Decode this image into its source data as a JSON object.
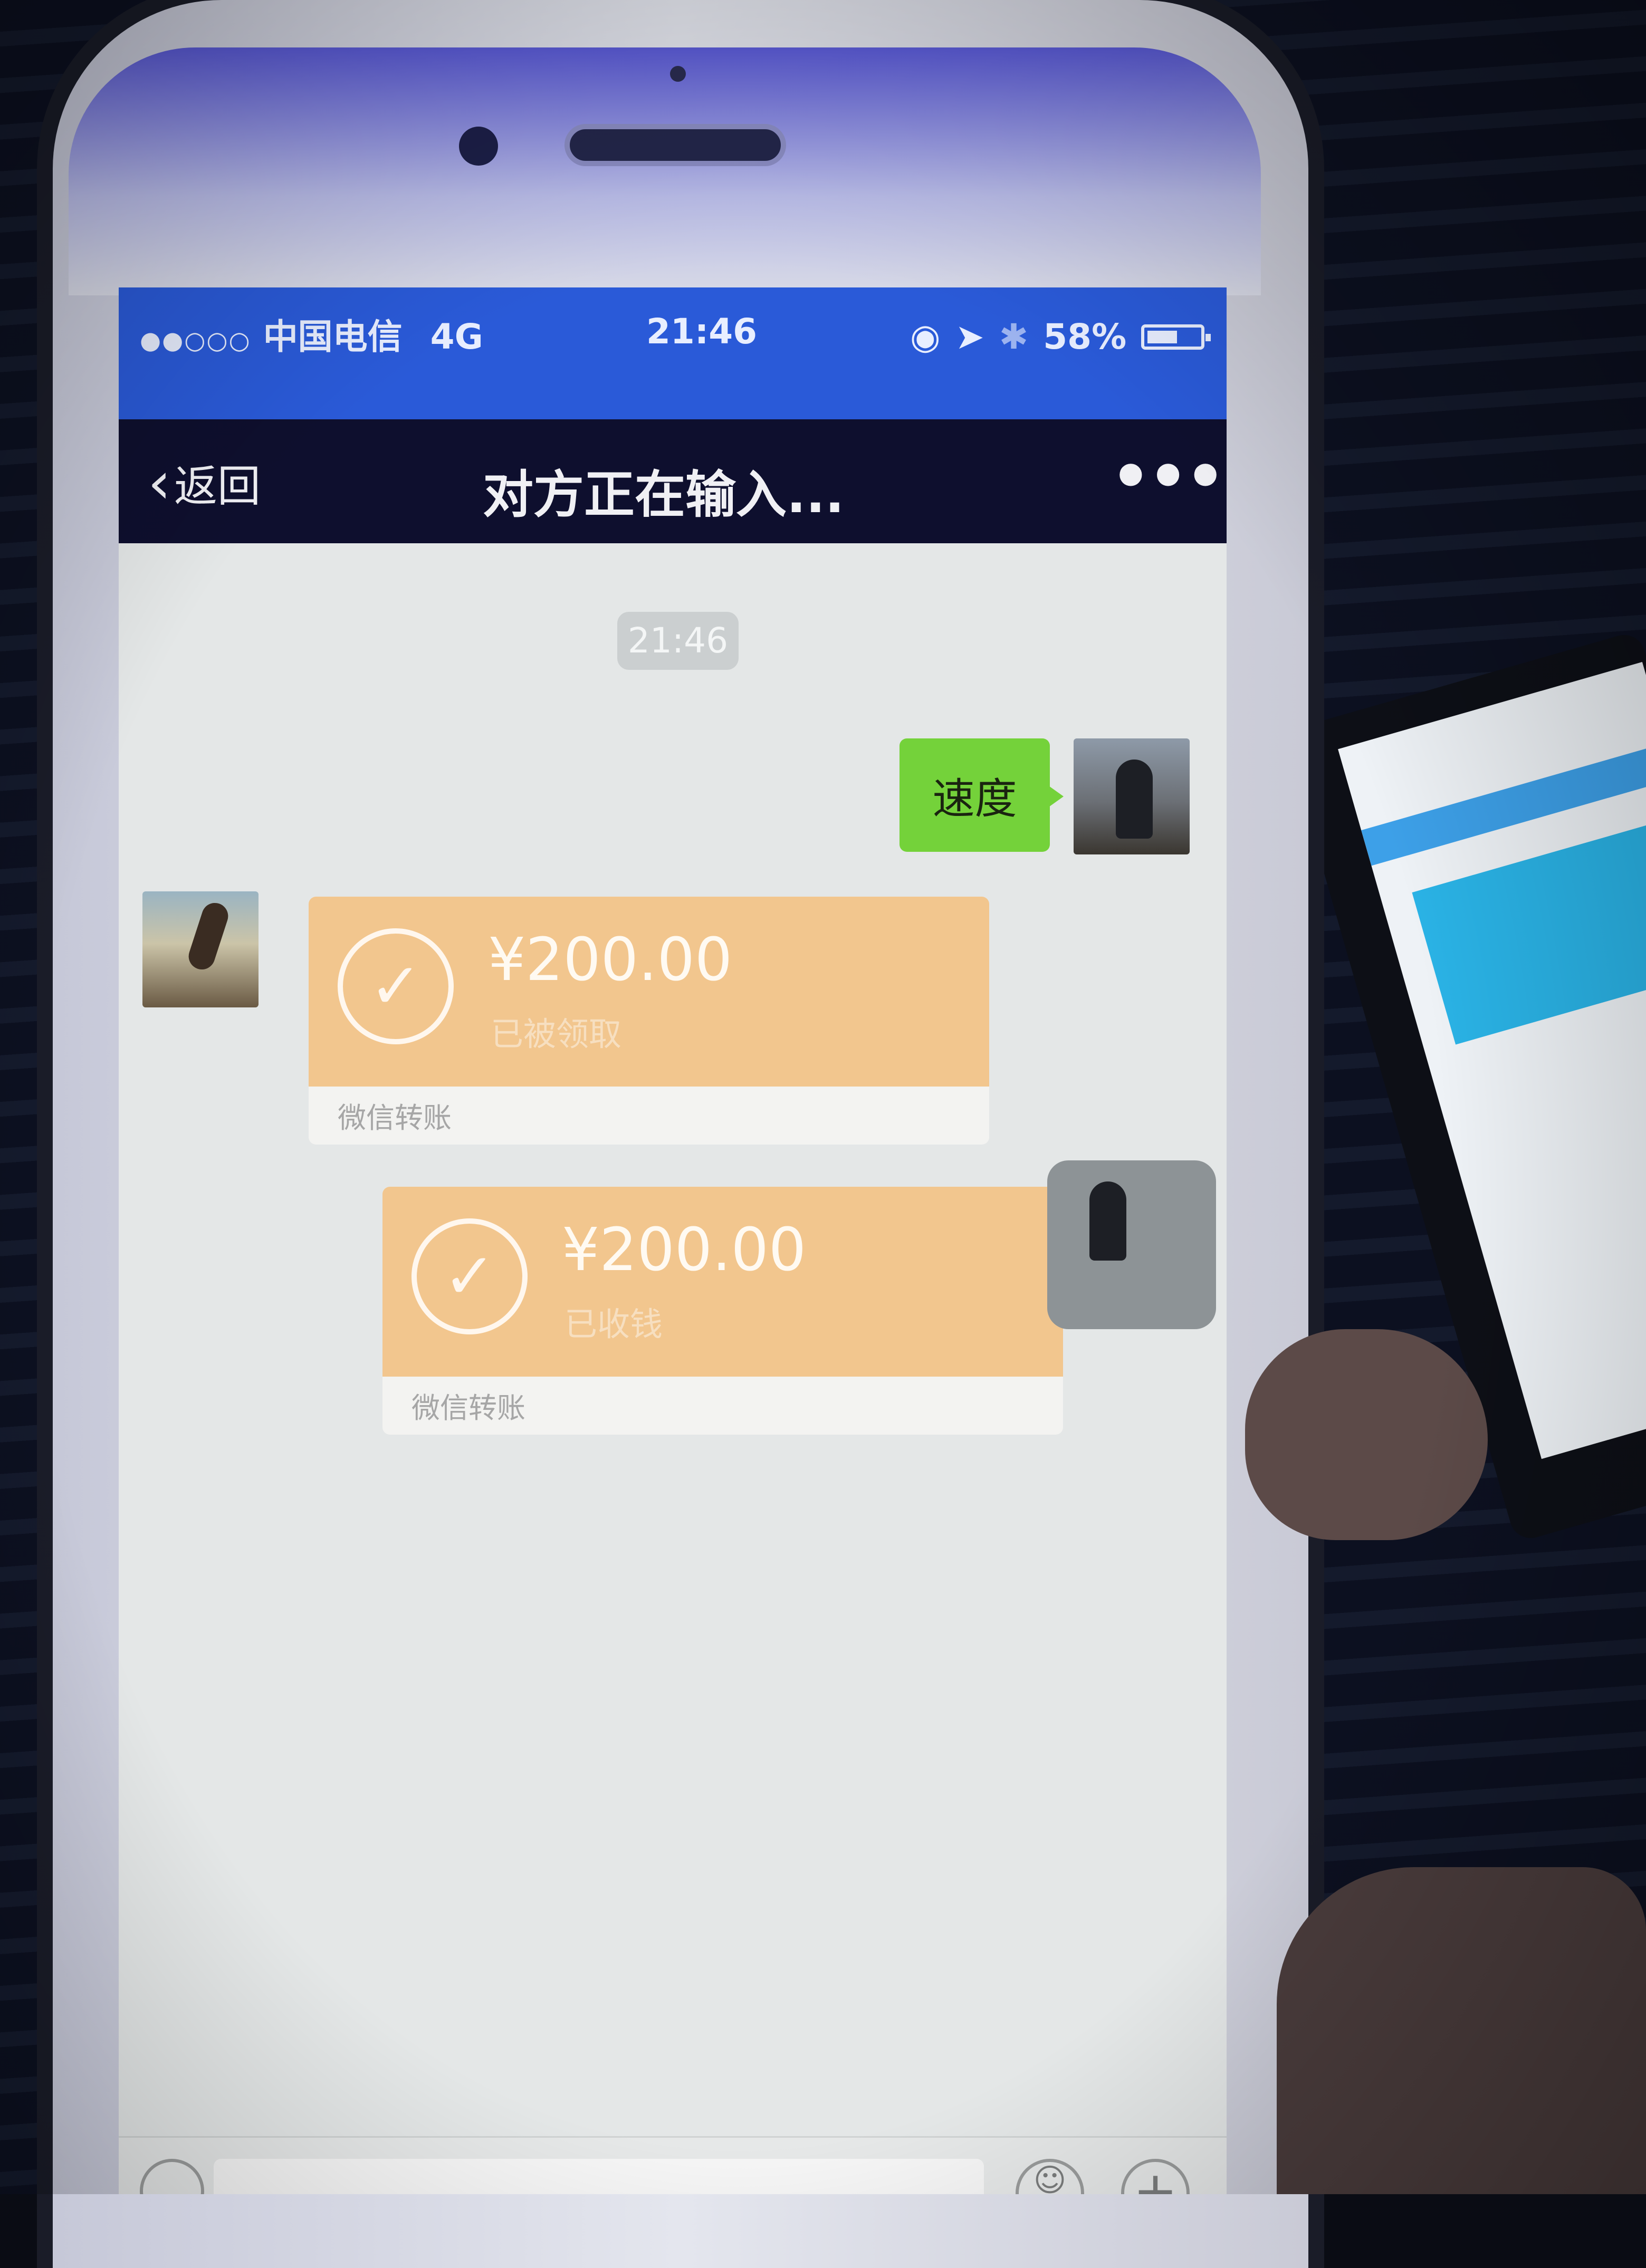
{
  "status_bar": {
    "signal": "●●○○○",
    "carrier": "中国电信",
    "network": "4G",
    "time": "21:46",
    "battery_percent": "58%",
    "battery_level": 0.58
  },
  "nav": {
    "back_label": "返回",
    "title": "对方正在输入...",
    "more_label": "•••"
  },
  "chat": {
    "timestamp": "21:46",
    "messages": [
      {
        "side": "right",
        "type": "text",
        "text": "速度"
      },
      {
        "side": "left",
        "type": "transfer",
        "amount": "¥200.00",
        "status": "已被领取",
        "footer": "微信转账"
      },
      {
        "side": "right",
        "type": "transfer",
        "amount": "¥200.00",
        "status": "已收钱",
        "footer": "微信转账"
      }
    ]
  },
  "colors": {
    "status_bar": "#2a5ad8",
    "nav_bar": "#0e0f2e",
    "green_bubble": "#74d23a",
    "transfer_bubble": "#f2c68e"
  },
  "icons": {
    "back": "chevron-left-icon",
    "more": "ellipsis-icon",
    "check": "checkmark-circle-icon",
    "emoji": "emoji-icon",
    "plus": "plus-icon"
  }
}
